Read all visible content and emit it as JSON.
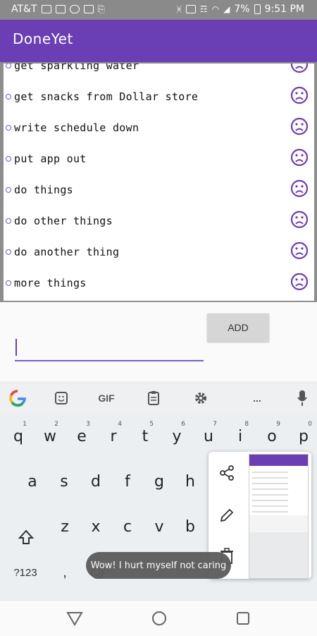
{
  "status_bar": {
    "carrier": "AT&T",
    "battery_pct": "7%",
    "time": "9:51 PM"
  },
  "app": {
    "title": "DoneYet"
  },
  "tasks": [
    {
      "text": "get sparkling water"
    },
    {
      "text": "get snacks from Dollar store"
    },
    {
      "text": "write schedule down"
    },
    {
      "text": "put app out"
    },
    {
      "text": "do things"
    },
    {
      "text": "do other things"
    },
    {
      "text": "do another thing"
    },
    {
      "text": "more things"
    }
  ],
  "form": {
    "add_label": "ADD",
    "input_value": ""
  },
  "keyboard": {
    "toolbar": {
      "gif": "GIF",
      "more": "..."
    },
    "row1": [
      {
        "k": "q",
        "h": "1"
      },
      {
        "k": "w",
        "h": "2"
      },
      {
        "k": "e",
        "h": "3"
      },
      {
        "k": "r",
        "h": "4"
      },
      {
        "k": "t",
        "h": "5"
      },
      {
        "k": "y",
        "h": "6"
      },
      {
        "k": "u",
        "h": "7"
      },
      {
        "k": "i",
        "h": "8"
      },
      {
        "k": "o",
        "h": "9"
      },
      {
        "k": "p",
        "h": "0"
      }
    ],
    "row2": [
      "a",
      "s",
      "d",
      "f",
      "g",
      "h"
    ],
    "row3": [
      "z",
      "x",
      "c",
      "v",
      "b"
    ],
    "symbols_key": "?123",
    "comma_key": ","
  },
  "toast": {
    "message": "Wow! I hurt myself not caring"
  },
  "colors": {
    "accent": "#6a3fb6",
    "underline": "#7b5cd1",
    "status_bar": "#8a8a8a",
    "face": "#6c3bbf"
  }
}
